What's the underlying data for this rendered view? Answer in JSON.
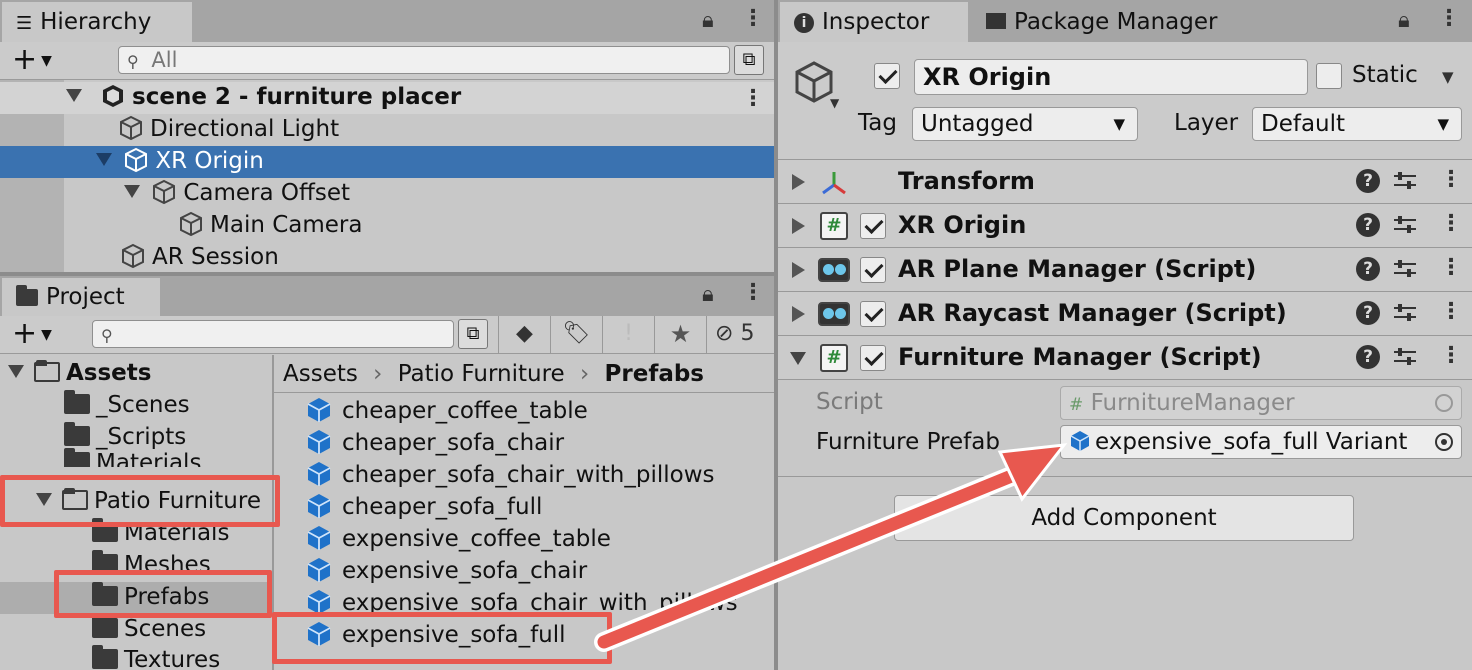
{
  "hierarchy": {
    "tab_label": "Hierarchy",
    "add_label": "+",
    "search_placeholder": "All",
    "rows": [
      {
        "label": "scene 2 - furniture placer"
      },
      {
        "label": "Directional Light"
      },
      {
        "label": "XR Origin"
      },
      {
        "label": "Camera Offset"
      },
      {
        "label": "Main Camera"
      },
      {
        "label": "AR Session"
      }
    ]
  },
  "project": {
    "tab_label": "Project",
    "add_label": "+",
    "hidden_count": "5",
    "tree": [
      {
        "label": "Assets"
      },
      {
        "label": "_Scenes"
      },
      {
        "label": "_Scripts"
      },
      {
        "label": "Materials"
      },
      {
        "label": "Patio Furniture"
      },
      {
        "label": "Materials"
      },
      {
        "label": "Meshes"
      },
      {
        "label": "Prefabs"
      },
      {
        "label": "Scenes"
      },
      {
        "label": "Textures"
      }
    ],
    "breadcrumb": [
      "Assets",
      "Patio Furniture",
      "Prefabs"
    ],
    "assets": [
      "cheaper_coffee_table",
      "cheaper_sofa_chair",
      "cheaper_sofa_chair_with_pillows",
      "cheaper_sofa_full",
      "expensive_coffee_table",
      "expensive_sofa_chair",
      "expensive_sofa_chair_with_pillows",
      "expensive_sofa_full"
    ]
  },
  "inspector": {
    "tab_label": "Inspector",
    "tab2_label": "Package Manager",
    "object_name": "XR Origin",
    "static_label": "Static",
    "tag_label": "Tag",
    "tag_value": "Untagged",
    "layer_label": "Layer",
    "layer_value": "Default",
    "components": [
      {
        "label": "Transform"
      },
      {
        "label": "XR Origin"
      },
      {
        "label": "AR Plane Manager (Script)"
      },
      {
        "label": "AR Raycast Manager (Script)"
      },
      {
        "label": "Furniture Manager (Script)"
      }
    ],
    "script_label": "Script",
    "script_value": "FurnitureManager",
    "prefab_label": "Furniture Prefab",
    "prefab_value": "expensive_sofa_full Variant",
    "add_component_label": "Add Component"
  },
  "colors": {
    "selection": "#3a72b0",
    "highlight_box": "#e8584f",
    "prefab_blue": "#1f72c9"
  }
}
